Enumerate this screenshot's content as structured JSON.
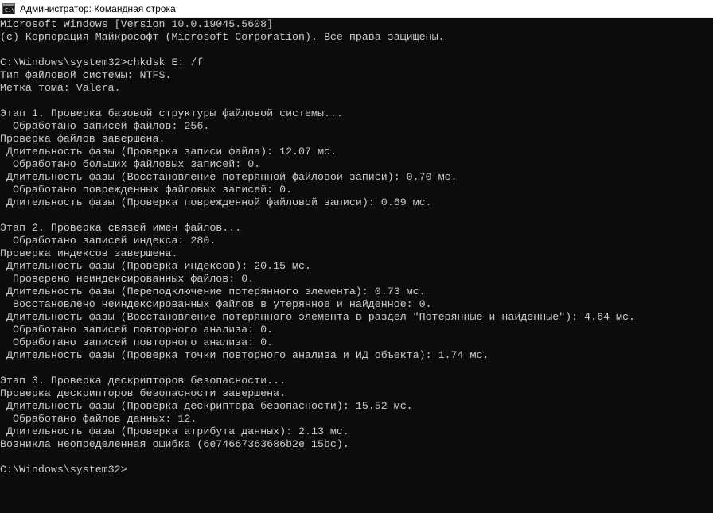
{
  "window": {
    "title": "Администратор: Командная строка",
    "icon": "cmd-icon",
    "icon_prompt": "C:\\"
  },
  "console": {
    "lines": [
      "Microsoft Windows [Version 10.0.19045.5608]",
      "(c) Корпорация Майкрософт (Microsoft Corporation). Все права защищены.",
      "",
      "C:\\Windows\\system32>chkdsk E: /f",
      "Тип файловой системы: NTFS.",
      "Метка тома: Valera.",
      "",
      "Этап 1. Проверка базовой структуры файловой системы...",
      "  Обработано записей файлов: 256.",
      "Проверка файлов завершена.",
      " Длительность фазы (Проверка записи файла): 12.07 мс.",
      "  Обработано больших файловых записей: 0.",
      " Длительность фазы (Восстановление потерянной файловой записи): 0.70 мс.",
      "  Обработано поврежденных файловых записей: 0.",
      " Длительность фазы (Проверка поврежденной файловой записи): 0.69 мс.",
      "",
      "Этап 2. Проверка связей имен файлов...",
      "  Обработано записей индекса: 280.",
      "Проверка индексов завершена.",
      " Длительность фазы (Проверка индексов): 20.15 мс.",
      "  Проверено неиндексированных файлов: 0.",
      " Длительность фазы (Переподключение потерянного элемента): 0.73 мс.",
      "  Восстановлено неиндексированных файлов в утерянное и найденное: 0.",
      " Длительность фазы (Восстановление потерянного элемента в раздел \"Потерянные и найденные\"): 4.64 мс.",
      "  Обработано записей повторного анализа: 0.",
      "  Обработано записей повторного анализа: 0.",
      " Длительность фазы (Проверка точки повторного анализа и ИД объекта): 1.74 мс.",
      "",
      "Этап 3. Проверка дескрипторов безопасности...",
      "Проверка дескрипторов безопасности завершена.",
      " Длительность фазы (Проверка дескриптора безопасности): 15.52 мс.",
      "  Обработано файлов данных: 12.",
      " Длительность фазы (Проверка атрибута данных): 2.13 мс.",
      "Возникла неопределенная ошибка (6e74667363686b2e 15bc).",
      "",
      "C:\\Windows\\system32>"
    ]
  },
  "colors": {
    "background": "#0c0c0c",
    "text": "#cccccc",
    "titlebar": "#ffffff"
  }
}
